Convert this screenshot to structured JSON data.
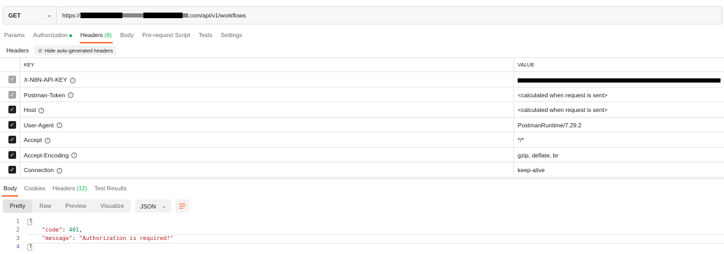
{
  "request": {
    "method": "GET",
    "url_prefix": "https://",
    "url_suffix": ".com/api/v1/workflows"
  },
  "request_tabs": [
    {
      "label": "Params"
    },
    {
      "label": "Authorization"
    },
    {
      "label": "Headers",
      "count": "(8)"
    },
    {
      "label": "Body"
    },
    {
      "label": "Pre-request Script"
    },
    {
      "label": "Tests"
    },
    {
      "label": "Settings"
    }
  ],
  "headers_section": {
    "label": "Headers",
    "hide_button": "Hide auto-generated headers"
  },
  "table": {
    "col_key": "KEY",
    "col_value": "VALUE",
    "rows": [
      {
        "key": "X-N8N-API-KEY",
        "value": "",
        "checked": true,
        "disabled": true
      },
      {
        "key": "Postman-Token",
        "value": "<calculated when request is sent>",
        "checked": true,
        "disabled": true
      },
      {
        "key": "Host",
        "value": "<calculated when request is sent>",
        "checked": true,
        "disabled": false
      },
      {
        "key": "User-Agent",
        "value": "PostmanRuntime/7.29.2",
        "checked": true,
        "disabled": false
      },
      {
        "key": "Accept",
        "value": "*/*",
        "checked": true,
        "disabled": false
      },
      {
        "key": "Accept-Encoding",
        "value": "gzip, deflate, br",
        "checked": true,
        "disabled": false
      },
      {
        "key": "Connection",
        "value": "keep-alive",
        "checked": true,
        "disabled": false
      }
    ]
  },
  "response_tabs": [
    {
      "label": "Body"
    },
    {
      "label": "Cookies"
    },
    {
      "label": "Headers",
      "count": "(12)"
    },
    {
      "label": "Test Results"
    }
  ],
  "view_modes": [
    "Pretty",
    "Raw",
    "Preview",
    "Visualize"
  ],
  "format": "JSON",
  "code": {
    "line_numbers": [
      "1",
      "2",
      "3",
      "4"
    ],
    "line1": "{",
    "line2_key": "\"code\"",
    "line2_sep": ": ",
    "line2_val": "401",
    "line2_end": ",",
    "line3_key": "\"message\"",
    "line3_sep": ": ",
    "line3_val": "\"Authorization is required!\"",
    "line4": "}"
  }
}
